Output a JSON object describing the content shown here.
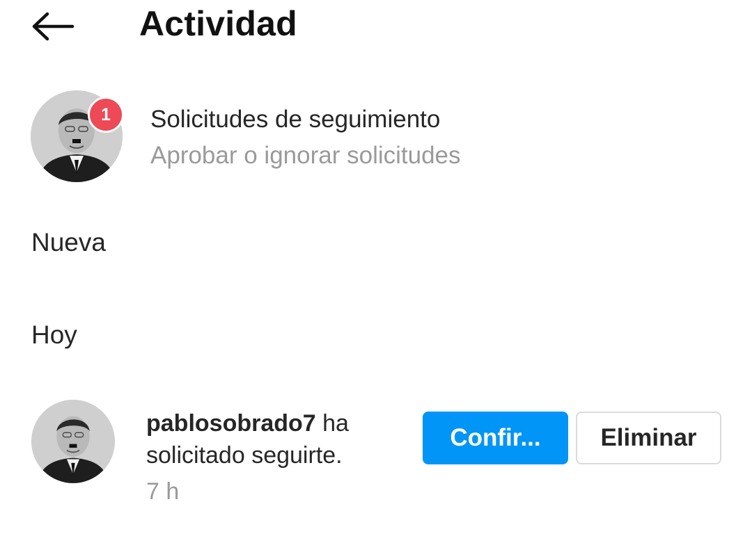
{
  "header": {
    "title": "Actividad",
    "back_icon": "arrow-left-icon"
  },
  "follow_requests": {
    "title": "Solicitudes de seguimiento",
    "subtitle": "Aprobar o ignorar solicitudes",
    "badge_count": "1",
    "badge_color": "#ed4956"
  },
  "sections": {
    "new_label": "Nueva",
    "today_label": "Hoy"
  },
  "notification": {
    "username": "pablosobrado7",
    "message_part1": " ha",
    "message_part2": "solicitado seguirte.",
    "time": "7 h",
    "confirm_label": "Confir...",
    "delete_label": "Eliminar",
    "confirm_color": "#0095f6"
  }
}
